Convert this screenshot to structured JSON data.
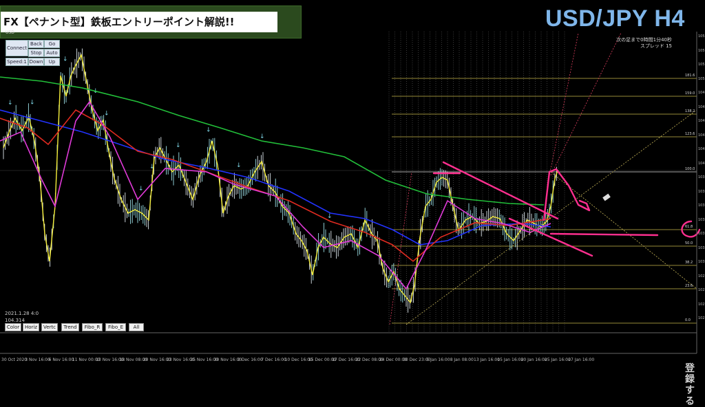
{
  "banner": {
    "title": "FX【ペナント型】鉄板エントリーポイント解説!!"
  },
  "pair_label": "USD/JPY H4",
  "symbol_small": "USD",
  "info_box": {
    "line1": "次の足まで0時間1分40秒",
    "line2": "スプレッド 15"
  },
  "control_panel": {
    "connect": "Connect",
    "back": "Back",
    "go": "Go",
    "stop": "Stop",
    "auto": "Auto",
    "speed": "Speed:1",
    "down": "Down",
    "up": "Up"
  },
  "readout": {
    "datetime": "2021.1.28 4:0",
    "price": "104.314"
  },
  "tool_buttons": [
    "Color",
    "Horiz",
    "Vertc",
    "Trend",
    "Fibo_R",
    "Fibo_E",
    "All"
  ],
  "fib_levels": [
    "181.6",
    "159.0",
    "138.2",
    "123.6",
    "100.0",
    "61.8",
    "50.0",
    "38.2",
    "23.6",
    "0.0"
  ],
  "y_ticks": [
    "105.",
    "105.",
    "105.",
    "105.",
    "104.",
    "104.",
    "104.",
    "104.",
    "104.",
    "104.",
    "103.",
    "103.",
    "103.",
    "103.",
    "103.",
    "103.",
    "103.",
    "102.",
    "102.",
    "102.",
    "102."
  ],
  "x_ticks": [
    "30 Oct 2020",
    "3 Nov 16:00",
    "6 Nov 16:00",
    "11 Nov 00:00",
    "13 Nov 16:00",
    "18 Nov 08:00",
    "20 Nov 16:00",
    "23 Nov 16:00",
    "25 Nov 16:00",
    "30 Nov 16:00",
    "3 Dec 16:00",
    "7 Dec 16:00",
    "10 Dec 16:00",
    "15 Dec 00:00",
    "17 Dec 16:00",
    "22 Dec 08:00",
    "24 Dec 00:00",
    "30 Dec 23:00",
    "5 Jan 16:00",
    "8 Jan 08:00",
    "13 Jan 16:00",
    "15 Jan 16:00",
    "20 Jan 16:00",
    "25 Jan 16:00",
    "27 Jan 16:00"
  ],
  "subscribe_label": "登録する",
  "colors": {
    "ma_green": "#22c03a",
    "ma_blue": "#2233ff",
    "ma_red": "#e02a20",
    "ma_magenta": "#e03ad8",
    "price": "#f6ef3a",
    "annotation": "#ff2f8f",
    "fib": "#c9b84a",
    "banner_bg": "#2b4a1e",
    "pair_text": "#7fb6ea"
  }
}
